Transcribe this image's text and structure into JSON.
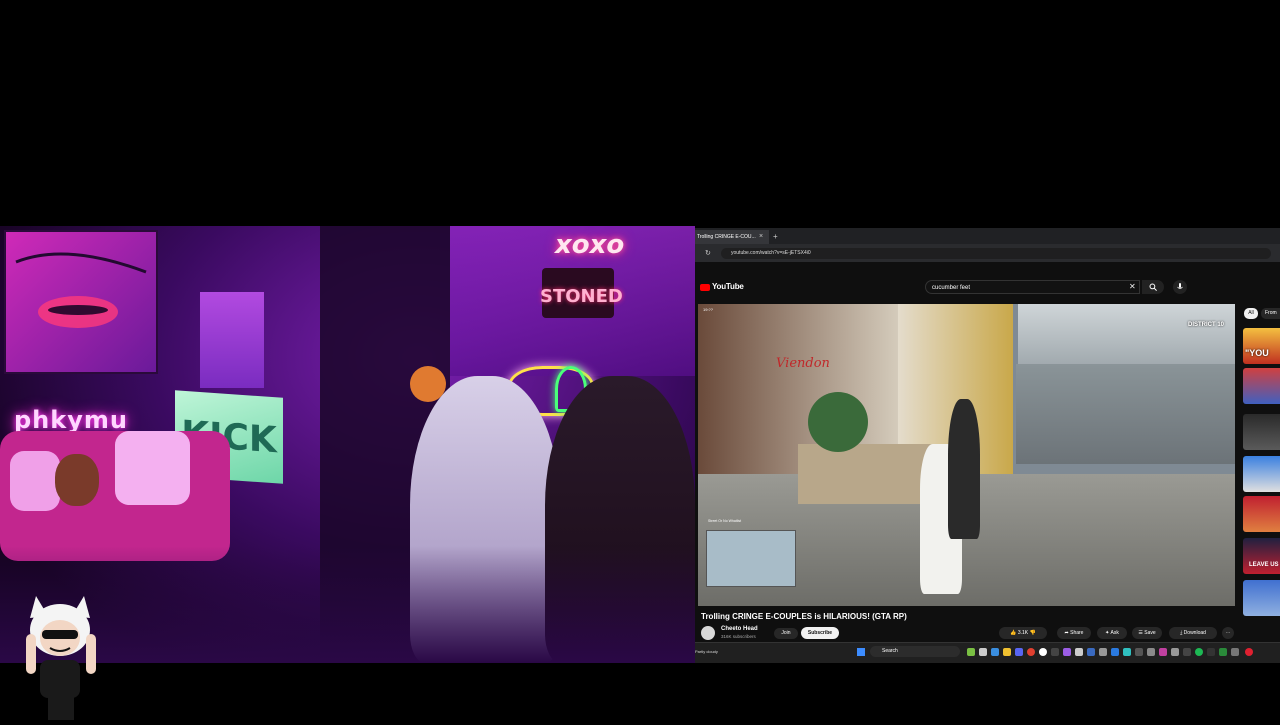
{
  "browser": {
    "tab_title": "Trolling CRINGE E-COU...",
    "tab_close": "×",
    "new_tab": "+",
    "refresh": "↻",
    "url": "youtube.com/watch?v=sE-jETSX4i0"
  },
  "youtube": {
    "logo_text": "YouTube",
    "search_query": "cucumber feet",
    "clear": "✕",
    "video": {
      "store_sign": "Viendon",
      "district_label": "DISTRICT 10",
      "timestamp": "19:??",
      "minimap_label": "Street Or No Whatlist"
    },
    "title": "Trolling CRINGE E-COUPLES is HILARIOUS! (GTA RP)",
    "channel": {
      "name": "Cheeto Head",
      "subscribers": "316K subscribers",
      "join": "Join",
      "subscribe": "Subscribe"
    },
    "actions": {
      "likes": "3.1K",
      "share": "Share",
      "ask": "Ask",
      "save": "Save",
      "download": "Download",
      "more": "⋯"
    },
    "chips": [
      "All",
      "From"
    ],
    "thumb_texts": [
      "\"YOU",
      "LEAVE US"
    ]
  },
  "taskbar": {
    "weather": "Partly cloudy",
    "search": "Search"
  },
  "stream": {
    "neon_left": "phkymu",
    "neon_top": "xoxo",
    "neon_stoned": "STONED",
    "sign": "KICK"
  },
  "colors": {
    "youtube_red": "#ff0000",
    "neon_pink": "#ff2ad8",
    "room_purple": "#7a1fb0"
  }
}
